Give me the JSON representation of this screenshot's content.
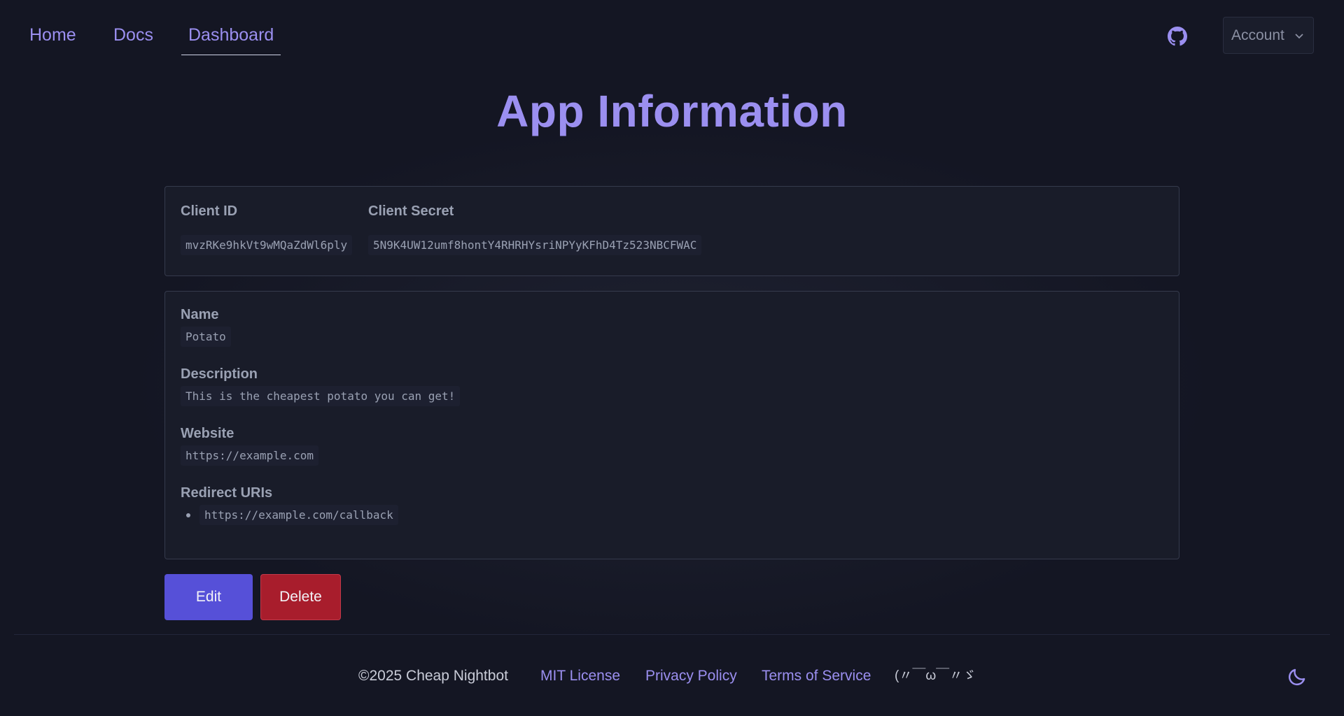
{
  "nav": {
    "links": [
      "Home",
      "Docs",
      "Dashboard"
    ],
    "active": "Dashboard",
    "github_icon": "github-icon",
    "account_label": "Account"
  },
  "page": {
    "title": "App Information"
  },
  "credentials": {
    "client_id_label": "Client ID",
    "client_id": "mvzRKe9hkVt9wMQaZdWl6ply",
    "client_secret_label": "Client Secret",
    "client_secret": "5N9K4UW12umf8hontY4RHRHYsriNPYyKFhD4Tz523NBCFWAC"
  },
  "details": {
    "name_label": "Name",
    "name": "Potato",
    "description_label": "Description",
    "description": "This is the cheapest potato you can get!",
    "website_label": "Website",
    "website": "https://example.com",
    "redirect_label": "Redirect URIs",
    "redirect_uris": [
      "https://example.com/callback"
    ]
  },
  "actions": {
    "edit": "Edit",
    "delete": "Delete"
  },
  "footer": {
    "copyright": "©2025 Cheap Nightbot",
    "links": [
      "MIT License",
      "Privacy Policy",
      "Terms of Service"
    ],
    "kaomoji": "(〃￣ω￣〃ゞ",
    "theme_icon": "moon-icon"
  },
  "colors": {
    "accent": "#9b8ff0",
    "background": "#141623",
    "card": "#191c29",
    "edit_button": "#5650d8",
    "delete_button": "#a81d2c"
  }
}
